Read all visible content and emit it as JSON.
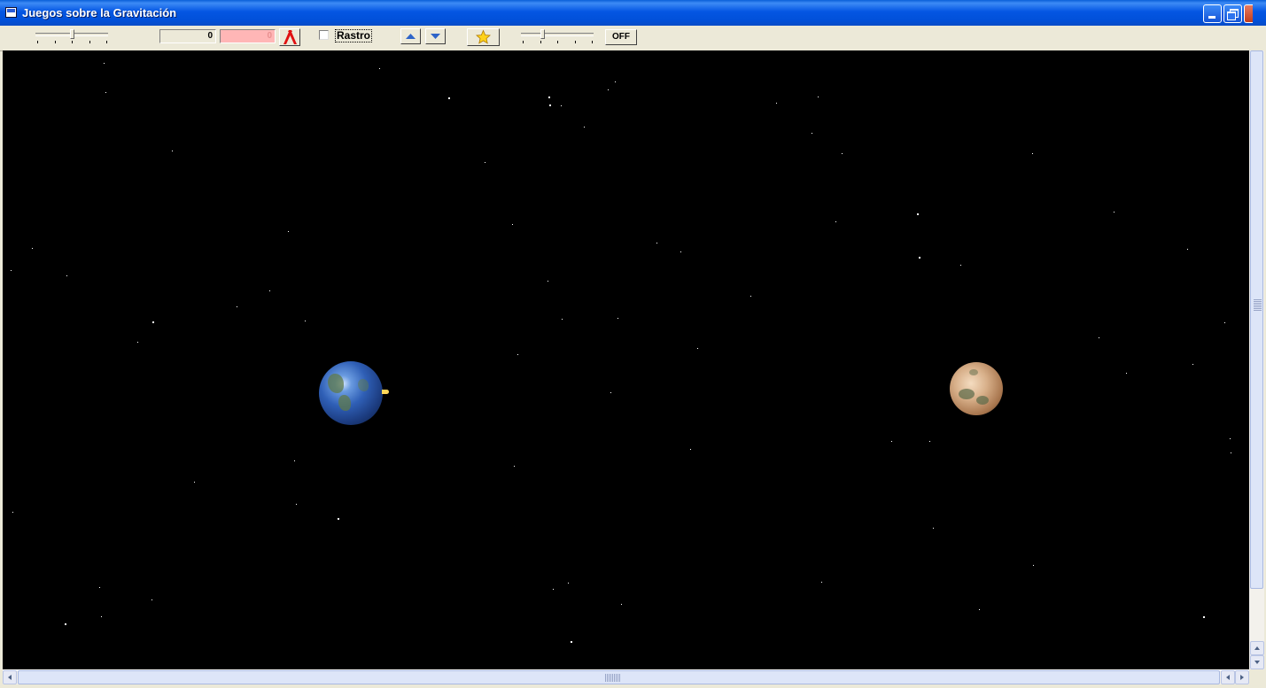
{
  "window": {
    "title": "Juegos sobre la Gravitación"
  },
  "toolbar": {
    "speed_slider_level": 0.5,
    "mass_slider_level": 0.28,
    "counter_value": "0",
    "pink_value": "0",
    "trail_checked": false,
    "trail_label": "Rastro",
    "toggle_label": "OFF"
  },
  "icons": {
    "reset": "red-caret-icon",
    "up": "up-arrow-icon",
    "down": "down-arrow-icon",
    "star": "star-icon"
  },
  "colors": {
    "titlebar": "#0456e3",
    "space_background": "#000000",
    "pink_field": "#ffb6b6",
    "star_button": "#ffd21a"
  },
  "scene": {
    "planets": [
      "earth",
      "mars"
    ]
  }
}
